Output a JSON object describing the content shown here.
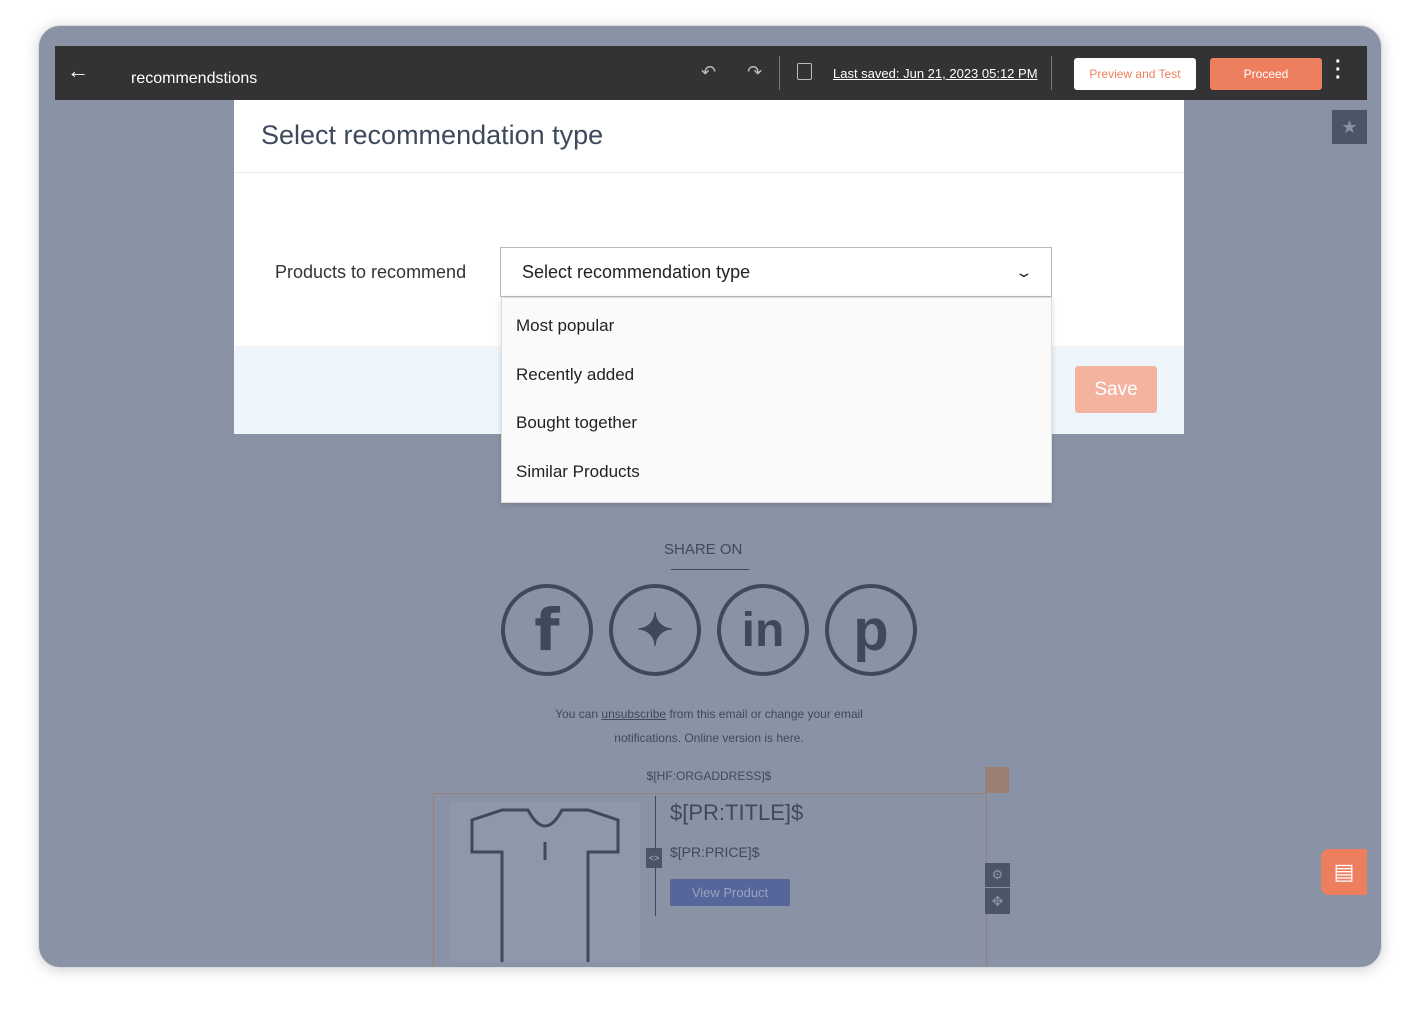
{
  "header": {
    "title": "recommendstions",
    "last_saved": "Last saved: Jun 21, 2023 05:12 PM",
    "preview_label": "Preview and Test",
    "proceed_label": "Proceed"
  },
  "modal": {
    "title": "Select recommendation type",
    "field_label": "Products to recommend",
    "dropdown_value": "Select recommendation type",
    "options": [
      "Most popular",
      "Recently added",
      "Bought together",
      "Similar Products"
    ],
    "save_label": "Save"
  },
  "email": {
    "share_on": "SHARE ON",
    "footer_pre": "You can ",
    "unsubscribe": "unsubscribe",
    "footer_post": " from this email or change your email",
    "footer_line2": "notifications. Online version is here.",
    "org_address": "$[HF:ORGADDRESS]$",
    "product_title": "$[PR:TITLE]$",
    "product_price": "$[PR:PRICE]$",
    "view_product": "View Product"
  },
  "colors": {
    "accent": "#ee7f5e",
    "topbar": "#333333",
    "overlay": "#8a93a5"
  }
}
